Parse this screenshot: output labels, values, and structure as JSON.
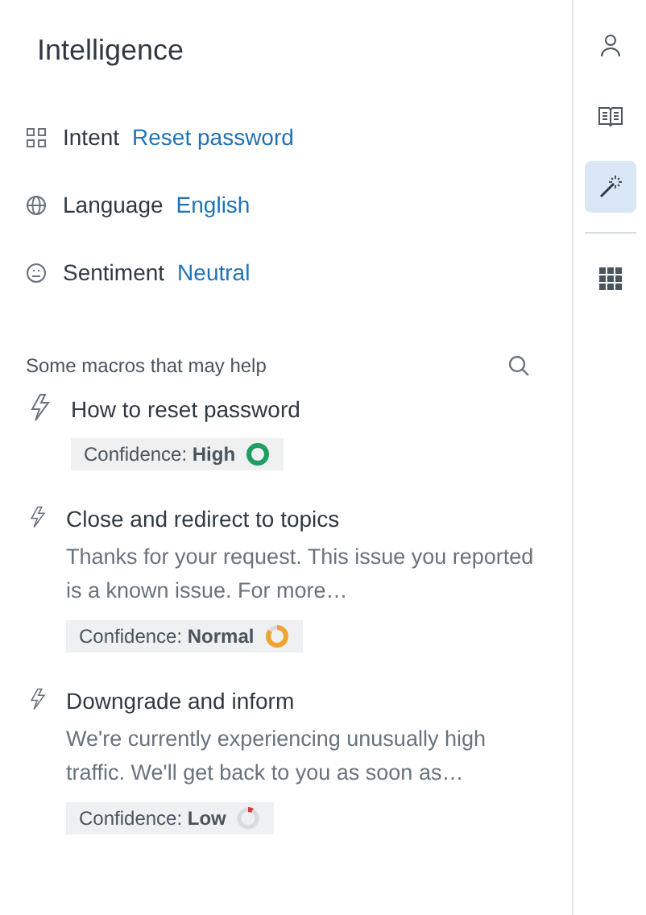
{
  "panel": {
    "title": "Intelligence"
  },
  "attributes": [
    {
      "kind": "intent",
      "label": "Intent",
      "value": "Reset password"
    },
    {
      "kind": "language",
      "label": "Language",
      "value": "English"
    },
    {
      "kind": "sentiment",
      "label": "Sentiment",
      "value": "Neutral"
    }
  ],
  "macros_section": {
    "heading": "Some macros that may help"
  },
  "macros": [
    {
      "title": "How to reset password",
      "confidence": "Confidence: **High**",
      "kind": "high",
      "color": "#1f9d62"
    },
    {
      "title": "Close and redirect to topics",
      "description": "Thanks for your request. This issue you reported is a known issue. For more…",
      "confidence": "Confidence: **Normal**",
      "kind": "normal",
      "color": "#f0a430"
    },
    {
      "title": "Downgrade and inform",
      "description": "We're currently experiencing unusually high traffic. We'll get back to you as soon as…",
      "confidence": "Confidence: **Low**",
      "kind": "low",
      "color": "#d93a3a"
    }
  ],
  "sidebar": {
    "items": [
      {
        "kind": "user",
        "selected": false
      },
      {
        "kind": "book",
        "selected": false
      },
      {
        "kind": "wand",
        "selected": true
      },
      {
        "kind": "apps",
        "selected": false
      }
    ]
  }
}
